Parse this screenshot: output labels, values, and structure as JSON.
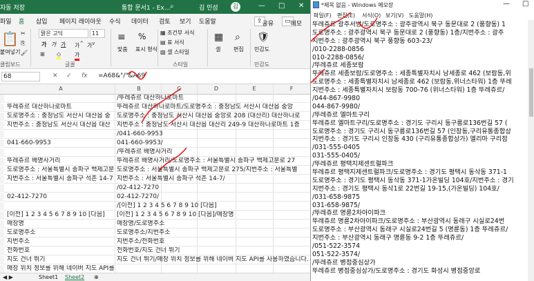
{
  "excel": {
    "title_left": "자동 저장",
    "doc_title": "통합 문서1 - Ex...",
    "search_icon": "search-icon",
    "user": "김 민성",
    "avatar": "김",
    "window_buttons": [
      "—",
      "□",
      "✕"
    ],
    "tabs": [
      "파일",
      "홈",
      "삽입",
      "페이지 레이아웃",
      "수식",
      "데이터",
      "검토",
      "보기",
      "도움말"
    ],
    "share_label": "공유",
    "memo_label": "메모",
    "ribbon": {
      "paste": "붙여넣기",
      "font_name": "맑은 고딕",
      "font_size": "11",
      "bold": "가",
      "italic": "가",
      "underline": "가",
      "align": "맞춤",
      "number_format": "표시 형식",
      "percent": "%",
      "conditional": "조건부 서식",
      "table_format": "표 서식",
      "cell_style": "셀 스타일",
      "cells": "셀",
      "editing": "편집",
      "sensitivity": "민감도",
      "groups": [
        "클립보드",
        "글꼴",
        "스타일",
        "민감도"
      ]
    },
    "name_box": "68",
    "formula": "=A68&\"/\"&A69",
    "columns": [
      "A",
      "B",
      "C",
      "D",
      "E",
      "F"
    ],
    "rows": [
      {
        "a": "",
        "b": "/뚜레쥬르 대산하나로마트"
      },
      {
        "a": "뚜레쥬르 대산하나로마트",
        "b": "뚜레쥬르 대산하나로마트/도로명주소 : 충청남도 서산시 대산읍 중앙"
      },
      {
        "a": "도로명주소 : 충청남도 서산시 대산읍 중",
        "b": "도로명주소 : 충청남도 서산시 대산읍 중앙로 208 (대산리) 대산하나로"
      },
      {
        "a": "지번주소 : 충청남도 서산시 대산읍 대산",
        "b": "지번주소 : 충청남도 서산시 대산읍 대산리 249-9 대산하나로마트 1층"
      },
      {
        "a": "",
        "b": "/041-660-9953"
      },
      {
        "a": "041-660-9953",
        "b": "041-660-9953/"
      },
      {
        "a": "",
        "b": "/뚜레쥬르 배명사거리"
      },
      {
        "a": "뚜레쥬르 배명사거리",
        "b": "뚜레쥬르 배명사거리/도로명주소 : 서울특별시 송파구 백제고분로 27"
      },
      {
        "a": "도로명주소 : 서울특별시 송파구 백제고분",
        "b": "도로명주소 : 서울특별시 송파구 백제고분로 275/지번주소 : 서울특별"
      },
      {
        "a": "지번주소 : 서울특별시 송파구 석촌 14-7",
        "b": "지번주소 : 서울특별시 송파구 석촌 14-7/"
      },
      {
        "a": "",
        "b": "/02-412-7270"
      },
      {
        "a": "02-412-7270",
        "b": "02-412-7270/"
      },
      {
        "a": "",
        "b": "/[이전] 1 2 3 4 5 6 7 8 9 10 [다음]"
      },
      {
        "a": "[이전] 1 2 3 4 5 6 7 8 9 10 [다음]",
        "b": "[이전] 1 2 3 4 5 6 7 8 9 10 [다음]/매장명"
      },
      {
        "a": "매장명",
        "b": "매장명/도로명주소"
      },
      {
        "a": "도로명주소",
        "b": "도로명주소/지번주소"
      },
      {
        "a": "지번주소",
        "b": "지번주소/전화번호"
      },
      {
        "a": "전화번호",
        "b": "전화번호/지도 건너 뛰기"
      },
      {
        "a": "지도 건너 뛰기",
        "b": "지도 건너 뛰기/매장 위치 정보를 위해 네이버 지도 API를 사용하였습니다."
      },
      {
        "a": "매장 위치 정보를 위해 네이버 지도 API를",
        "b": ""
      }
    ],
    "sheets": [
      "Sheet1",
      "Sheet2"
    ],
    "add_sheet": "⊕"
  },
  "notepad": {
    "title": "*제목 없음 - Windows 메모장",
    "window_buttons": [
      "—",
      "□"
    ],
    "menu": [
      "파일(F)",
      "편집(E)",
      "서식(O)",
      "보기(V)",
      "도움말(H)"
    ],
    "lines": [
      "뚜레쥬르 광주서방/도로명주소 : 광주광역시 북구 동문대로 2 (풍향동) 1",
      "도로명주소 : 광주광역시 북구 동문대로 2 (풍향동) 1층/지번주소 : 광주",
      "지번주소 : 광주광역시 북구 풍향동 603-23/",
      "/010-2288-0856",
      "010-2288-0856/",
      "/뚜레쥬르 세종보람",
      "뚜레쥬르 세종보람/도로명주소 : 세종특별자치시 남세종로 462 (보람동,위",
      "도로명주소 : 세종특별자치시 남세종로 462 (보람동,위너스타워) 1층 뚜레",
      "지번주소 : 세종특별자치시 보람동 700-76 (위너스타워) 1층 뚜레쥬르/",
      "/044-867-9980",
      "044-867-9980/",
      "/뚜레쥬르 엘마트구리",
      "뚜레쥬르 엘마트구리/도로명주소 : 경기도 구리시 동구릉로136번길 57 (",
      "도로명주소 : 경기도 구리시 동구릉로136번길 57 (인창동,구리유통종합상",
      "지번주소 : 경기도 구리시 인창동 430 (구리유통종합상가) 엘리마 구리점",
      "/031-555-0405",
      "031-555-0405/",
      "/뚜레쥬르 평택지제센트럴파크",
      "뚜레쥬르 평택지제센트럴파크/도로명주소 : 경기도 평택시 동삭동 371-1",
      "도로명주소 : 경기도 평택시 동삭동 371-1가온빌딩 104호/지번주소 : 경기",
      "지번주소 : 경기도 평택시 동삭1로 22번길 19-15,(가온빌딩) 104호/",
      "/031-658-9875",
      "031-658-9875/",
      "/뚜레쥬르 명륜2차아이파크",
      "뚜레쥬르 명륜2차아이파크/도로명주소 : 부산광역시 동래구 시실로24번",
      "도로명주소 : 부산광역시 동래구 시실로24번길 5 (명륜동) 1층 뚜레쥬르/",
      "지번주소 : 부산광역시 동래구 명륜동 9-2 1층 뚜레쥬르/",
      "/051-522-3574",
      "051-522-3574/",
      "/뚜레쥬르 병점중심상가",
      "뚜레쥬르 병점중심상가/도로명주소 : 경기도 화성시 병점중앙로"
    ]
  }
}
